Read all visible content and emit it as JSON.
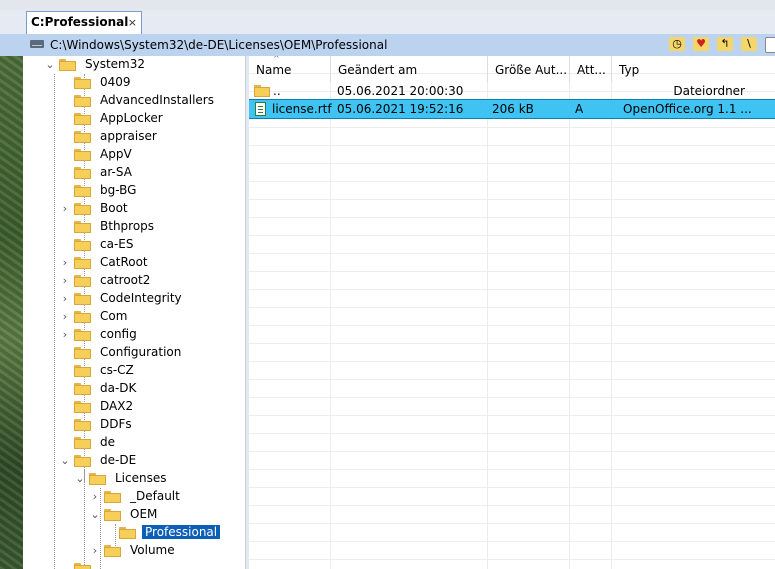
{
  "tabs": [
    {
      "label": "C:Professional",
      "close_icon": "×"
    }
  ],
  "address": {
    "path": "C:\\Windows\\System32\\de-DE\\Licenses\\OEM\\Professional"
  },
  "tree": [
    {
      "label": "System32",
      "expander": "⌄"
    },
    {
      "label": "0409",
      "expander": ""
    },
    {
      "label": "AdvancedInstallers",
      "expander": ""
    },
    {
      "label": "AppLocker",
      "expander": ""
    },
    {
      "label": "appraiser",
      "expander": ""
    },
    {
      "label": "AppV",
      "expander": ""
    },
    {
      "label": "ar-SA",
      "expander": ""
    },
    {
      "label": "bg-BG",
      "expander": ""
    },
    {
      "label": "Boot",
      "expander": "›"
    },
    {
      "label": "Bthprops",
      "expander": ""
    },
    {
      "label": "ca-ES",
      "expander": ""
    },
    {
      "label": "CatRoot",
      "expander": "›"
    },
    {
      "label": "catroot2",
      "expander": "›"
    },
    {
      "label": "CodeIntegrity",
      "expander": "›"
    },
    {
      "label": "Com",
      "expander": "›"
    },
    {
      "label": "config",
      "expander": "›"
    },
    {
      "label": "Configuration",
      "expander": ""
    },
    {
      "label": "cs-CZ",
      "expander": ""
    },
    {
      "label": "da-DK",
      "expander": ""
    },
    {
      "label": "DAX2",
      "expander": ""
    },
    {
      "label": "DDFs",
      "expander": ""
    },
    {
      "label": "de",
      "expander": ""
    },
    {
      "label": "de-DE",
      "expander": "⌄"
    },
    {
      "label": "Licenses",
      "expander": "⌄"
    },
    {
      "label": "_Default",
      "expander": "›"
    },
    {
      "label": "OEM",
      "expander": "⌄"
    },
    {
      "label": "Professional",
      "expander": ""
    },
    {
      "label": "Volume",
      "expander": "›"
    }
  ],
  "columns": {
    "name": "Name",
    "modified": "Geändert am",
    "size": "Größe Aut...",
    "attr": "Att...",
    "type": "Typ"
  },
  "rows": [
    {
      "name": "..",
      "modified": "05.06.2021 20:00:30",
      "size": "",
      "attr": "",
      "type": "Dateiordner"
    },
    {
      "name": "license.rtf",
      "modified": "05.06.2021 19:52:16",
      "size": "206 kB",
      "attr": "A",
      "type": "OpenOffice.org 1.1 ..."
    }
  ],
  "colors": {
    "selection": "#3fc3f2",
    "tree_selection": "#0b5fb7",
    "address_bar": "#bcd3ef"
  }
}
